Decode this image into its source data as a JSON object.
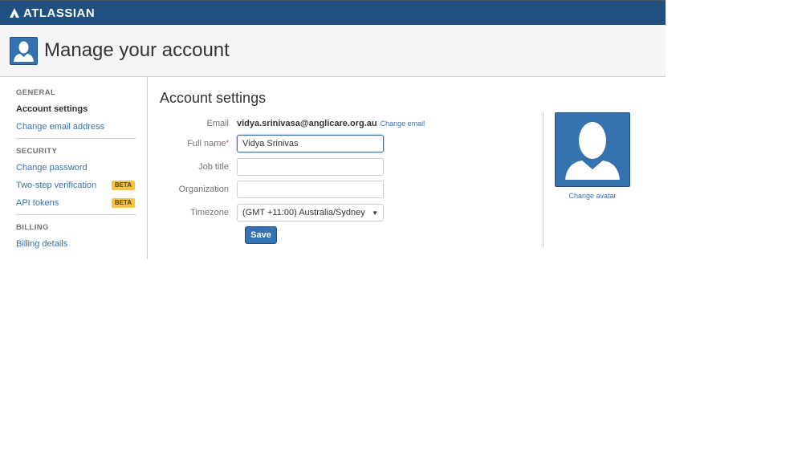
{
  "brand": {
    "name": "ATLASSIAN"
  },
  "header": {
    "title": "Manage your account"
  },
  "sidebar": {
    "sections": [
      {
        "label": "GENERAL",
        "items": [
          {
            "label": "Account settings"
          },
          {
            "label": "Change email address"
          }
        ]
      },
      {
        "label": "SECURITY",
        "items": [
          {
            "label": "Change password"
          },
          {
            "label": "Two-step verification",
            "badge": "BETA"
          },
          {
            "label": "API tokens",
            "badge": "BETA"
          }
        ]
      },
      {
        "label": "BILLING",
        "items": [
          {
            "label": "Billing details"
          }
        ]
      }
    ]
  },
  "main": {
    "title": "Account settings",
    "email": {
      "label": "Email",
      "value": "vidya.srinivasa@anglicare.org.au",
      "change_link": "Change email"
    },
    "full_name": {
      "label": "Full name",
      "required": "*",
      "value": "Vidya Srinivas"
    },
    "job_title": {
      "label": "Job title",
      "value": ""
    },
    "organization": {
      "label": "Organization",
      "value": ""
    },
    "timezone": {
      "label": "Timezone",
      "value": "(GMT +11:00) Australia/Sydney"
    },
    "save_label": "Save"
  },
  "avatar": {
    "change_label": "Change avatar"
  },
  "colors": {
    "brand": "#205081",
    "link": "#3572b0",
    "beta": "#f6c342"
  }
}
